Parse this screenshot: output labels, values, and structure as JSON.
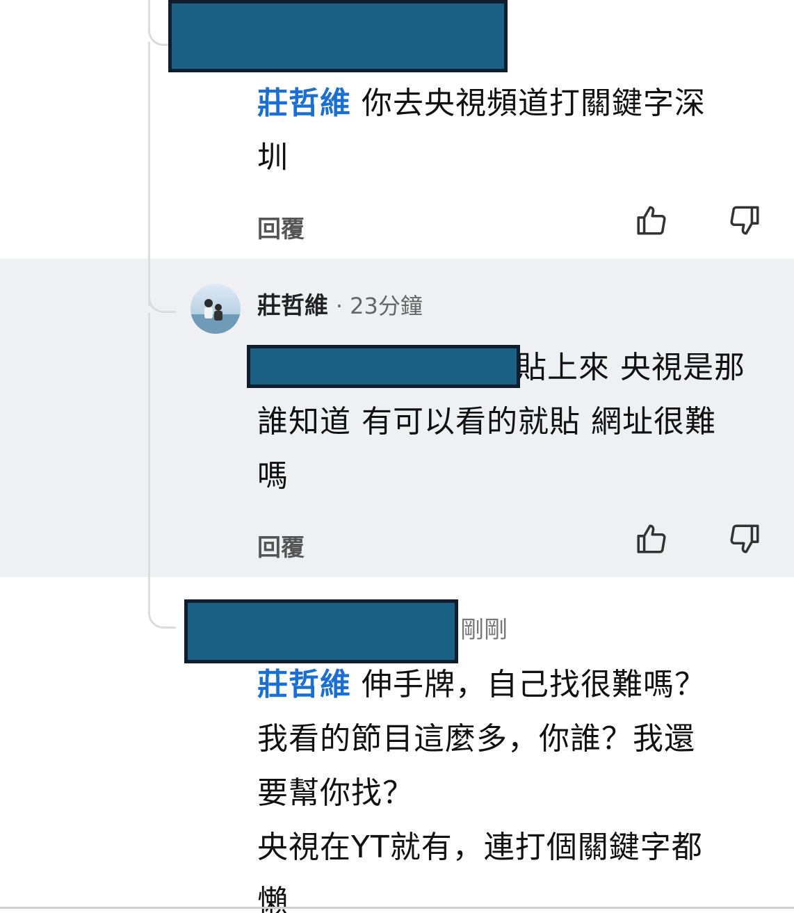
{
  "comment1": {
    "mention": "莊哲維",
    "line1": "你去央視頻道打關鍵字深",
    "line2": "圳",
    "reply_label": "回覆"
  },
  "comment2": {
    "author": "莊哲維",
    "time": "· 23分鐘",
    "line1_visible": "貼上來 央視是那",
    "line2": "誰知道 有可以看的就貼 網址很難",
    "line3": "嗎",
    "reply_label": "回覆"
  },
  "comment3": {
    "time": "剛剛",
    "mention": "莊哲維",
    "line1": "伸手牌，自己找很難嗎？",
    "line2": "我看的節目這麼多，你誰？我還",
    "line3": "要幫你找？",
    "line4": "央視在YT就有，連打個關鍵字都",
    "line5_partial": "懶"
  },
  "icons": {
    "like": "thumbs-up-icon",
    "dislike": "thumbs-down-icon"
  },
  "colors": {
    "mention": "#1a6fd1",
    "redaction_fill": "#1a5f84",
    "redaction_border": "#0f1e2c",
    "highlight_band": "#eef0f4"
  }
}
